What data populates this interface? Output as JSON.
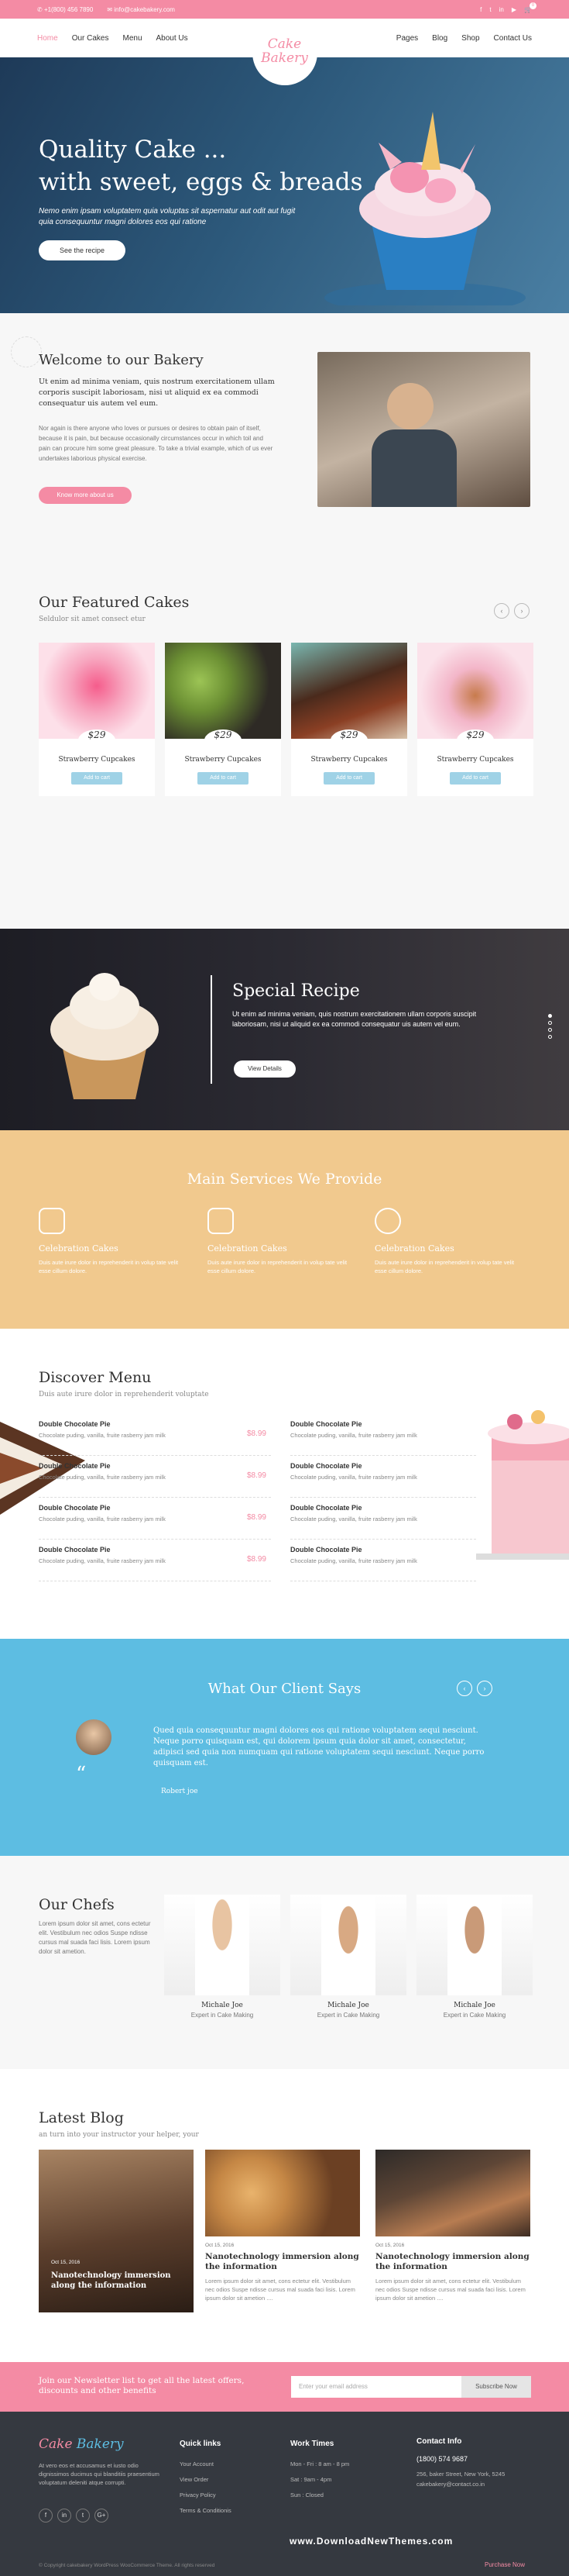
{
  "topbar": {
    "phone": "+1(800) 456 7890",
    "email": "info@cakebakery.com"
  },
  "nav": {
    "left": [
      "Home",
      "Our Cakes",
      "Menu",
      "About Us"
    ],
    "right": [
      "Pages",
      "Blog",
      "Shop",
      "Contact Us"
    ],
    "logo_line1": "Cake",
    "logo_line2": "Bakery",
    "cart_count": "0"
  },
  "hero": {
    "line1": "Quality Cake ...",
    "line2": "with sweet, eggs & breads",
    "text": "Nemo enim ipsam voluptatem quia voluptas sit aspernatur aut odit aut fugit quia consequuntur magni dolores eos qui ratione",
    "button": "See the recipe"
  },
  "welcome": {
    "title": "Welcome to our Bakery",
    "lead": "Ut enim ad minima veniam, quis nostrum exercitationem ullam corporis suscipit laboriosam, nisi ut aliquid ex ea commodi consequatur uis autem vel eum.",
    "body": "Nor again is there anyone who loves or pursues or desires to obtain pain of itself, because it is pain, but because occasionally circumstances occur in which toil and pain can procure him some great pleasure. To take a trivial example, which of us ever undertakes laborious physical exercise.",
    "button": "Know more about us"
  },
  "cakes": {
    "title": "Our Featured Cakes",
    "subtitle": "Seldulor sit amet consect etur",
    "items": [
      {
        "price": "$29",
        "name": "Strawberry Cupcakes",
        "button": "Add to cart"
      },
      {
        "price": "$29",
        "name": "Strawberry Cupcakes",
        "button": "Add to cart"
      },
      {
        "price": "$29",
        "name": "Strawberry Cupcakes",
        "button": "Add to cart"
      },
      {
        "price": "$29",
        "name": "Strawberry Cupcakes",
        "button": "Add to cart"
      }
    ]
  },
  "special": {
    "title": "Special Recipe",
    "text": "Ut enim ad minima veniam, quis nostrum exercitationem ullam corporis suscipit laboriosam, nisi ut aliquid ex ea commodi consequatur uis autem vel eum.",
    "button": "View Details"
  },
  "services": {
    "title": "Main Services We Provide",
    "items": [
      {
        "title": "Celebration Cakes",
        "text": "Duis aute irure dolor in reprehenderit in volup tate velit esse cillum dolore."
      },
      {
        "title": "Celebration Cakes",
        "text": "Duis aute irure dolor in reprehenderit in volup tate velit esse cillum dolore."
      },
      {
        "title": "Celebration Cakes",
        "text": "Duis aute irure dolor in reprehenderit in volup tate velit esse cillum dolore."
      }
    ]
  },
  "menu": {
    "title": "Discover Menu",
    "subtitle": "Duis aute irure dolor in reprehenderit voluptate",
    "items": [
      {
        "name": "Double Chocolate Pie",
        "desc": "Chocolate puding, vanilla, fruite rasberry jam milk",
        "price": "$8.99"
      },
      {
        "name": "Double Chocolate Pie",
        "desc": "Chocolate puding, vanilla, fruite rasberry jam milk",
        "price": "$8.99"
      },
      {
        "name": "Double Chocolate Pie",
        "desc": "Chocolate puding, vanilla, fruite rasberry jam milk",
        "price": "$8.99"
      },
      {
        "name": "Double Chocolate Pie",
        "desc": "Chocolate puding, vanilla, fruite rasberry jam milk",
        "price": "$8.99"
      },
      {
        "name": "Double Chocolate Pie",
        "desc": "Chocolate puding, vanilla, fruite rasberry jam milk",
        "price": ""
      },
      {
        "name": "Double Chocolate Pie",
        "desc": "Chocolate puding, vanilla, fruite rasberry jam milk",
        "price": ""
      },
      {
        "name": "Double Chocolate Pie",
        "desc": "Chocolate puding, vanilla, fruite rasberry jam milk",
        "price": ""
      },
      {
        "name": "Double Chocolate Pie",
        "desc": "Chocolate puding, vanilla, fruite rasberry jam milk",
        "price": ""
      }
    ]
  },
  "testimonial": {
    "title": "What Our Client Says",
    "text": "Qued quia consequuntur magni dolores eos qui ratione voluptatem sequi nesciunt. Neque porro quisquam est, qui dolorem ipsum quia dolor sit amet, consectetur, adipisci sed quia non numquam qui ratione voluptatem sequi nesciunt. Neque porro quisquam est.",
    "author": "Robert joe"
  },
  "chefs": {
    "title": "Our Chefs",
    "text": "Lorem ipsum dolor sit amet, cons ectetur elit. Vestibulum nec odios Suspe ndisse cursus mal suada faci lisis. Lorem ipsum dolor sit ametion.",
    "items": [
      {
        "name": "Michale Joe",
        "role": "Expert in Cake Making"
      },
      {
        "name": "Michale Joe",
        "role": "Expert in Cake Making"
      },
      {
        "name": "Michale Joe",
        "role": "Expert in Cake Making"
      }
    ]
  },
  "blog": {
    "title": "Latest Blog",
    "subtitle": "an turn into your instructor your helper, your",
    "posts": [
      {
        "date": "Oct 15, 2016",
        "title": "Nanotechnology immersion along the information",
        "text": ""
      },
      {
        "date": "Oct 15, 2016",
        "title": "Nanotechnology immersion along the information",
        "text": "Lorem ipsum dolor sit amet, cons ectetur elit. Vestibulum nec odios Suspe ndisse cursus mal suada faci lisis. Lorem ipsum dolor sit ametion ...."
      },
      {
        "date": "Oct 15, 2016",
        "title": "Nanotechnology immersion along the information",
        "text": "Lorem ipsum dolor sit amet, cons ectetur elit. Vestibulum nec odios Suspe ndisse cursus mal suada faci lisis. Lorem ipsum dolor sit ametion ...."
      }
    ]
  },
  "newsletter": {
    "text": "Join our Newsletter list to get all the latest offers, discounts and other benefits",
    "placeholder": "Enter your email address",
    "button": "Subscribe Now"
  },
  "footer": {
    "logo1": "Cake",
    "logo2": "Bakery",
    "about": "At vero eos et accusamus et iusto odio dignissimos ducimus qui blanditiis praesentium voluptatum deleniti atque corrupti.",
    "quick": {
      "title": "Quick links",
      "items": [
        "Your Account",
        "View Order",
        "Privacy Policy",
        "Terms & Conditionis"
      ]
    },
    "hours": {
      "title": "Work Times",
      "items": [
        "Mon - Fri : 8 am - 8 pm",
        "Sat : 9am - 4pm",
        "Sun : Closed"
      ]
    },
    "contact": {
      "title": "Contact Info",
      "items": [
        "(1800) 574 9687",
        "256, baker Street, New York, 5245",
        "cakebakery@contact.co.in"
      ]
    },
    "copyright": "© Copyright cakebakery WordPress WooCommerce Theme. All rights reserved",
    "watermark": "www.DownloadNewThemes.com",
    "purchase": "Purchase Now"
  },
  "colors": {
    "pink": "#f48ba4",
    "blue": "#5dbde2",
    "peach": "#f1c98e",
    "dark": "#353940"
  }
}
